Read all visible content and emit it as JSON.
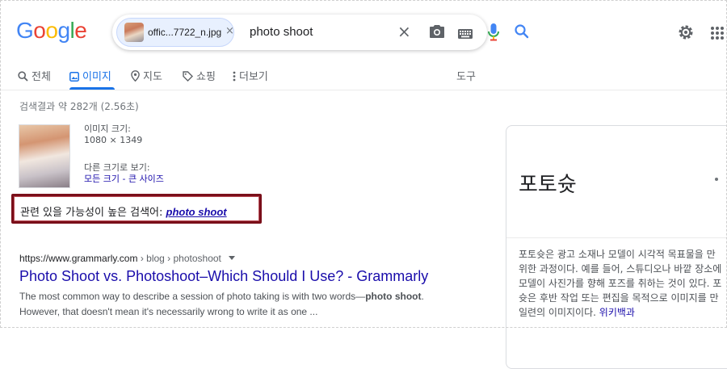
{
  "logo": {
    "text": "Google",
    "letters": [
      "G",
      "o",
      "o",
      "g",
      "l",
      "e"
    ],
    "colors": [
      "#4285F4",
      "#EA4335",
      "#FBBC05",
      "#4285F4",
      "#34A853",
      "#EA4335"
    ]
  },
  "search": {
    "image_chip": {
      "filename": "offic...7722_n.jpg",
      "close": "×"
    },
    "query": "photo shoot",
    "clear": "×"
  },
  "tabs": [
    {
      "label": "전체",
      "icon": "search-icon"
    },
    {
      "label": "이미지",
      "icon": "image-icon",
      "active": true
    },
    {
      "label": "지도",
      "icon": "map-pin-icon"
    },
    {
      "label": "쇼핑",
      "icon": "tag-icon"
    },
    {
      "label": "더보기",
      "icon": "more-vert-icon"
    }
  ],
  "tools_label": "도구",
  "result_stats": "검색결과 약 282개 (2.56초)",
  "image_info": {
    "size_label": "이미지 크기:",
    "size_value": "1080 × 1349",
    "other_sizes_label": "다른 크기로 보기:",
    "other_sizes_link": "모든 크기 - 큰 사이즈"
  },
  "related_search": {
    "label": "관련 있을 가능성이 높은 검색어:",
    "query": "photo shoot",
    "highlight_color": "#7a0f1a"
  },
  "result": {
    "cite_domain": "https://www.grammarly.com",
    "cite_path": " › blog › photoshoot",
    "title": "Photo Shoot vs. Photoshoot–Which Should I Use? - Grammarly",
    "snippet_line1_pre": "The most common way to describe a session of photo taking is with two words—",
    "snippet_line1_bold": "photo shoot",
    "snippet_line1_post": ".",
    "snippet_line2": "However, that doesn't mean it's necessarily wrong to write it as one ..."
  },
  "knowledge_panel": {
    "title": "포토슛",
    "description_lines": [
      "포토슛은 광고 소재나 모델이 시각적 목표물을 만",
      "위한 과정이다. 예를 들어, 스튜디오나 바깥 장소에",
      "모델이 사진가를 향해 포즈를 취하는 것이 있다. 포",
      "슛은 후반 작업 또는 편집을 목적으로 이미지를 만",
      "일련의 이미지이다."
    ],
    "source_link": "위키백과"
  },
  "colors": {
    "link": "#1a0dab",
    "accent": "#1a73e8"
  }
}
